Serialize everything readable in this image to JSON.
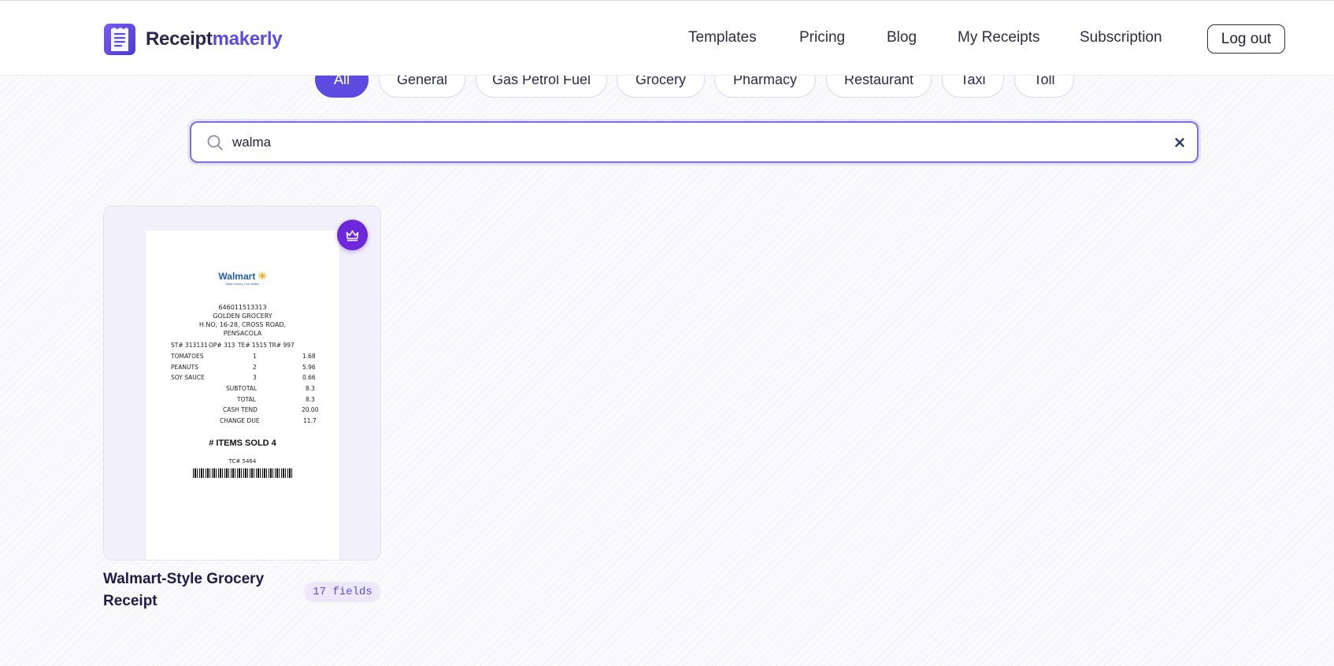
{
  "header": {
    "brand_part1": "Receipt",
    "brand_part2": "makerly",
    "nav": [
      "Templates",
      "Pricing",
      "Blog",
      "My Receipts",
      "Subscription"
    ],
    "logout_label": "Log out"
  },
  "filters": {
    "chips": [
      "All",
      "General",
      "Gas Petrol Fuel",
      "Grocery",
      "Pharmacy",
      "Restaurant",
      "Taxi",
      "Toll"
    ],
    "active": "All"
  },
  "search": {
    "value": "walma"
  },
  "results": [
    {
      "title": "Walmart-Style Grocery Receipt",
      "fields_badge": "17 fields",
      "premium_icon": "crown-icon",
      "preview": {
        "logo_text": "Walmart",
        "logo_spark": "✳",
        "tagline": "Save money. Live better.",
        "store_id": "646011513313",
        "store_name": "GOLDEN GROCERY",
        "address_line1": "H.NO, 16-28, CROSS ROAD,",
        "address_line2": "PENSACOLA",
        "ids": [
          "ST# 313131",
          "OP# 313",
          "TE# 1515",
          "TR# 997"
        ],
        "items": [
          {
            "name": "TOMATOES",
            "qty": "1",
            "price": "1.68"
          },
          {
            "name": "PEANUTS",
            "qty": "2",
            "price": "5.96"
          },
          {
            "name": "SOY SAUCE",
            "qty": "3",
            "price": "0.66"
          }
        ],
        "totals": [
          {
            "label": "SUBTOTAL",
            "value": "8.3"
          },
          {
            "label": "TOTAL",
            "value": "8.3"
          },
          {
            "label": "CASH TEND",
            "value": "20.00"
          },
          {
            "label": "CHANGE DUE",
            "value": "11.7"
          }
        ],
        "items_sold": "# ITEMS SOLD 4",
        "tc": "TC# 5464"
      }
    }
  ],
  "colors": {
    "accent": "#5b4be0",
    "premium": "#6d28d9",
    "brand_dark": "#2a2650"
  }
}
